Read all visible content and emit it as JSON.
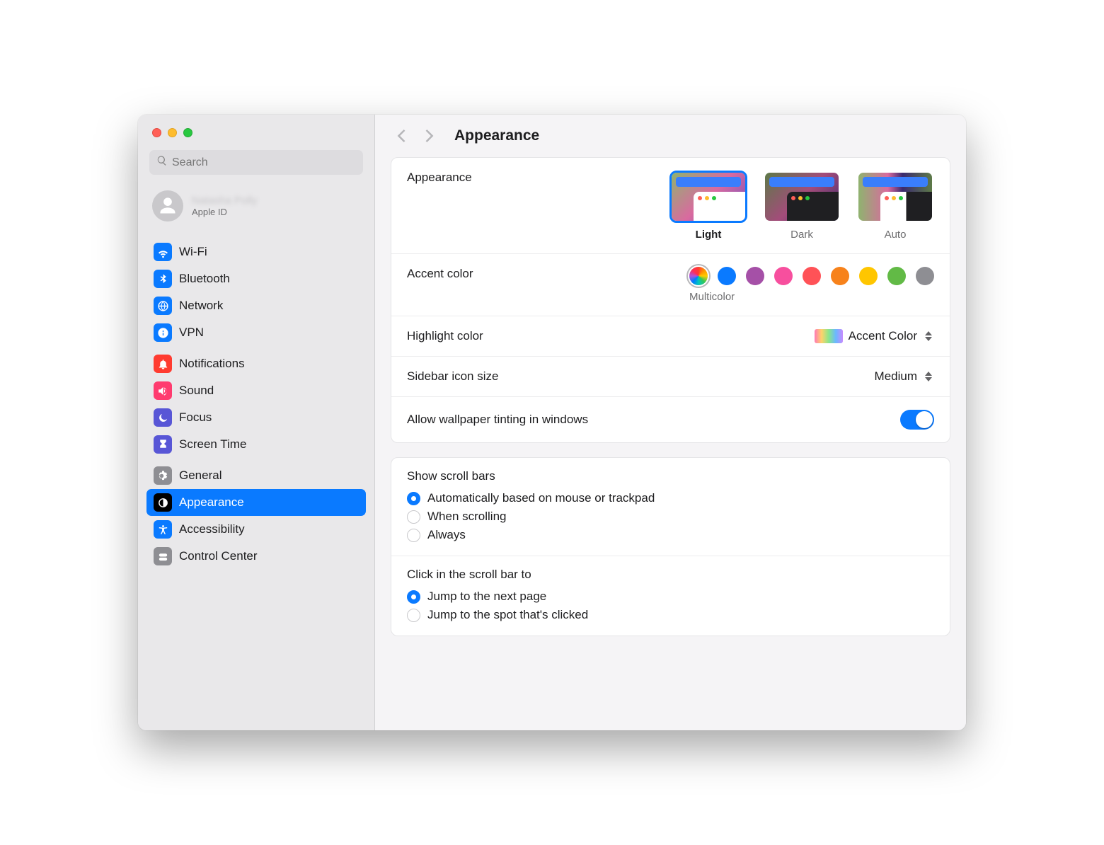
{
  "search_placeholder": "Search",
  "account": {
    "name": "Natasha Polly",
    "subtitle": "Apple ID"
  },
  "sidebar": {
    "group1": [
      {
        "label": "Wi-Fi",
        "bg": "#0a7aff",
        "icon": "wifi"
      },
      {
        "label": "Bluetooth",
        "bg": "#0a7aff",
        "icon": "bluetooth"
      },
      {
        "label": "Network",
        "bg": "#0a7aff",
        "icon": "globe"
      },
      {
        "label": "VPN",
        "bg": "#0a7aff",
        "icon": "vpn"
      }
    ],
    "group2": [
      {
        "label": "Notifications",
        "bg": "#ff3b30",
        "icon": "bell"
      },
      {
        "label": "Sound",
        "bg": "#ff3b6f",
        "icon": "speaker"
      },
      {
        "label": "Focus",
        "bg": "#5856d6",
        "icon": "moon"
      },
      {
        "label": "Screen Time",
        "bg": "#5856d6",
        "icon": "hourglass"
      }
    ],
    "group3": [
      {
        "label": "General",
        "bg": "#8e8e93",
        "icon": "gear"
      },
      {
        "label": "Appearance",
        "bg": "#000000",
        "icon": "appearance",
        "selected": true
      },
      {
        "label": "Accessibility",
        "bg": "#0a7aff",
        "icon": "access"
      },
      {
        "label": "Control Center",
        "bg": "#8e8e93",
        "icon": "switches"
      }
    ]
  },
  "page_title": "Appearance",
  "appearance": {
    "section_label": "Appearance",
    "modes": [
      {
        "label": "Light",
        "selected": true
      },
      {
        "label": "Dark",
        "selected": false
      },
      {
        "label": "Auto",
        "selected": false
      }
    ]
  },
  "accent": {
    "label": "Accent color",
    "caption": "Multicolor",
    "colors": [
      "multi",
      "#0a7aff",
      "#a550a7",
      "#f74f9e",
      "#ff5257",
      "#f7821b",
      "#ffc600",
      "#62ba46",
      "#8e8e93"
    ],
    "selected_index": 0
  },
  "highlight": {
    "label": "Highlight color",
    "value": "Accent Color"
  },
  "sidebar_icon": {
    "label": "Sidebar icon size",
    "value": "Medium"
  },
  "tinting": {
    "label": "Allow wallpaper tinting in windows",
    "on": true
  },
  "scrollbars": {
    "label": "Show scroll bars",
    "options": [
      {
        "label": "Automatically based on mouse or trackpad",
        "checked": true
      },
      {
        "label": "When scrolling",
        "checked": false
      },
      {
        "label": "Always",
        "checked": false
      }
    ]
  },
  "scrollclick": {
    "label": "Click in the scroll bar to",
    "options": [
      {
        "label": "Jump to the next page",
        "checked": true
      },
      {
        "label": "Jump to the spot that's clicked",
        "checked": false
      }
    ]
  }
}
